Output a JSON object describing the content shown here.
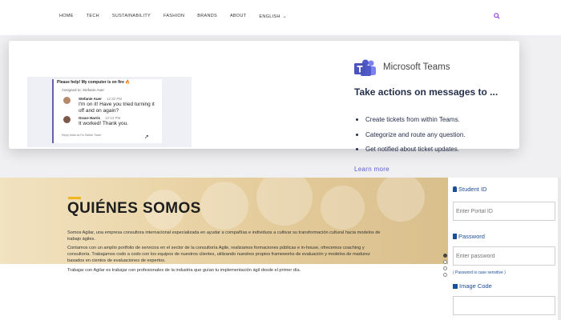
{
  "nav": {
    "items": [
      "HOME",
      "TECH",
      "SUSTAINABILITY",
      "FASHION",
      "BRANDS",
      "ABOUT",
      "ENGLISH"
    ]
  },
  "teams_popup": {
    "chat": {
      "title": "Please help! My computer is on fire 🔥",
      "assigned": "Assigned to: Stefanie Auer",
      "messages": [
        {
          "name": "Stefanie Auer",
          "time": "12:32 PM",
          "text": "I'm on it! Have you tried turning it off and on again?"
        },
        {
          "name": "Grace Harris",
          "time": "10:13 PM",
          "text": "It worked! Thank you."
        }
      ],
      "footer": "Reply     Mark as Fix     Delete Ticket"
    },
    "brand_name": "Microsoft Teams",
    "headline": "Take actions on messages to ...",
    "bullets": [
      "Create tickets from within Teams.",
      "Categorize and route any question.",
      "Get notified about ticket updates."
    ],
    "learn_more": "Learn more"
  },
  "hero": {
    "title": "QUIÉNES SOMOS",
    "paragraphs": [
      "Somos Agilar, una empresa consultora internacional especializada en ayudar a compañías e individuos a cultivar su transformación cultural hacia modelos de trabajo ágiles.",
      "Contamos con un amplio portfolio de servicios en el sector de la consultoría Agile, realizamos formaciones públicas e in-house, ofrecemos coaching y consultoría. Trabajamos codo a codo con los equipos de nuestros clientes, utilizando nuestros propios frameworks de evaluación y modelos de madurez basados en cientos de evaluaciones de expertos.",
      "Trabajar con Agilar es trabajar con profesionales de la industria que guían tu implementación ágil desde el primer día."
    ]
  },
  "login": {
    "student_id_label": "Student ID",
    "portal_placeholder": "Enter Portal ID",
    "password_label": "Password",
    "password_placeholder": "Enter password",
    "password_hint": "( Password is case sensitive )",
    "image_code_label": "Image Code"
  },
  "colors": {
    "teams_purple": "#5b5fc7",
    "navy_text": "#252f4a",
    "accent_yellow": "#f2b51c",
    "login_blue": "#1c4f99"
  }
}
